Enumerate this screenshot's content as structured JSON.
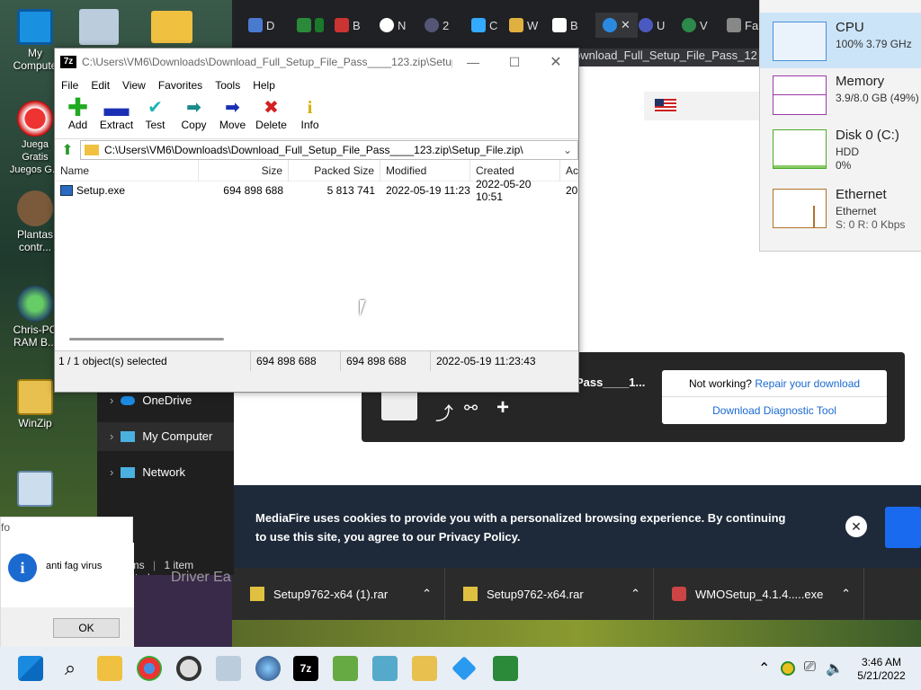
{
  "desktop": {
    "icons": [
      {
        "label": "My Compute"
      },
      {
        "label": "Juega Gratis Juegos G..."
      },
      {
        "label": "Plantas contr..."
      },
      {
        "label": "Chris-PC RAM B..."
      },
      {
        "label": "WinZip"
      }
    ]
  },
  "browser": {
    "tabs": [
      "D",
      "B",
      "N",
      "2",
      "C",
      "W",
      "B",
      "U",
      "V",
      "Fa"
    ],
    "page_title_partial": "ownload_Full_Setup_File_Pass_12",
    "file_name_partial": "Pass____1...",
    "not_working_text": "Not working?",
    "repair_link": "Repair your download",
    "diagnostic_button": "Download Diagnostic Tool",
    "cookie_text": "MediaFire uses cookies to provide you with a personalized browsing experience. By continuing to use this site, you agree to our Privacy Policy.",
    "driver_text": "Driver Ea",
    "downloads": [
      {
        "name": "Setup9762-x64 (1).rar"
      },
      {
        "name": "Setup9762-x64.rar"
      },
      {
        "name": "WMOSetup_4.1.4.....exe"
      }
    ]
  },
  "explorer": {
    "items": [
      "OneDrive",
      "My Computer",
      "Network"
    ],
    "status_items": "2 items",
    "status_selected": "1 item selected"
  },
  "sevenzip": {
    "title": "C:\\Users\\VM6\\Downloads\\Download_Full_Setup_File_Pass____123.zip\\Setup_...",
    "app_icon": "7z",
    "menu": [
      "File",
      "Edit",
      "View",
      "Favorites",
      "Tools",
      "Help"
    ],
    "toolbar": [
      {
        "label": "Add",
        "icon": "+",
        "color": "#1faa1f"
      },
      {
        "label": "Extract",
        "icon": "−",
        "color": "#1b2fb5"
      },
      {
        "label": "Test",
        "icon": "✔",
        "color": "#1fb5b5"
      },
      {
        "label": "Copy",
        "icon": "➡",
        "color": "#1a8a8a"
      },
      {
        "label": "Move",
        "icon": "➡",
        "color": "#1b2fb5"
      },
      {
        "label": "Delete",
        "icon": "✖",
        "color": "#d42020"
      },
      {
        "label": "Info",
        "icon": "i",
        "color": "#d4b000"
      }
    ],
    "address": "C:\\Users\\VM6\\Downloads\\Download_Full_Setup_File_Pass____123.zip\\Setup_File.zip\\",
    "columns": [
      "Name",
      "Size",
      "Packed Size",
      "Modified",
      "Created",
      "Ac"
    ],
    "rows": [
      {
        "name": "Setup.exe",
        "size": "694 898 688",
        "packed": "5 813 741",
        "modified": "2022-05-19 11:23",
        "created": "2022-05-20 10:51",
        "accessed": "20"
      }
    ],
    "status": {
      "selected": "1 / 1 object(s) selected",
      "size": "694 898 688",
      "packed": "694 898 688",
      "date": "2022-05-19 11:23:43"
    }
  },
  "taskmgr": {
    "items": [
      {
        "title": "CPU",
        "sub1": "100% 3.79 GHz",
        "sub2": "",
        "color": "#4a90d9"
      },
      {
        "title": "Memory",
        "sub1": "3.9/8.0 GB (49%)",
        "sub2": "",
        "color": "#9c3aa8"
      },
      {
        "title": "Disk 0 (C:)",
        "sub1": "HDD",
        "sub2": "0%",
        "color": "#4caa2a"
      },
      {
        "title": "Ethernet",
        "sub1": "Ethernet",
        "sub2": "S: 0 R: 0 Kbps",
        "color": "#b0722a"
      }
    ]
  },
  "dialog": {
    "header": "fo",
    "message": "anti fag virus",
    "ok": "OK"
  },
  "taskbar": {
    "time": "3:46 AM",
    "date": "5/21/2022"
  }
}
